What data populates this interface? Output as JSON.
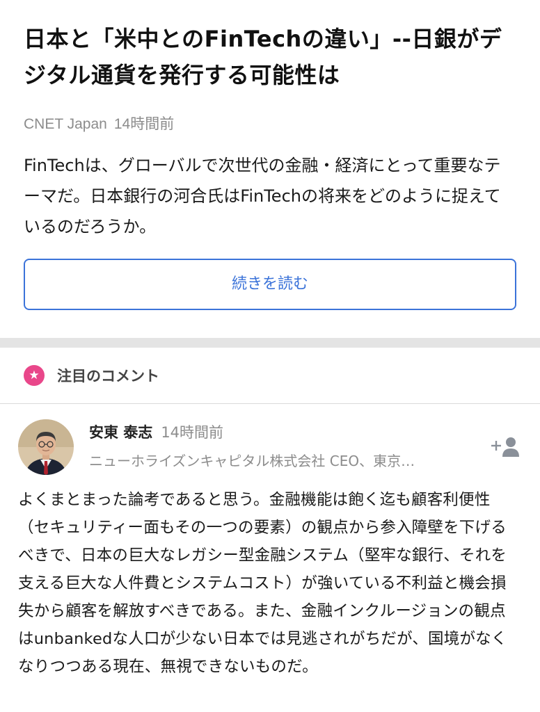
{
  "article": {
    "headline": "日本と「米中とのFinTechの違い」--日銀がデジタル通貨を発行する可能性は",
    "source": "CNET Japan",
    "time": "14時間前",
    "summary": "FinTechは、グローバルで次世代の金融・経済にとって重要なテーマだ。日本銀行の河合氏はFinTechの将来をどのように捉えているのだろうか。",
    "read_more_label": "続きを読む"
  },
  "comments_section": {
    "title": "注目のコメント",
    "badge_icon": "star-icon",
    "accent_color": "#e9478a"
  },
  "comment": {
    "author": "安東 泰志",
    "time": "14時間前",
    "affiliation": "ニューホライズンキャピタル株式会社 CEO、東京…",
    "follow_icon": "add-user-icon",
    "body": "よくまとまった論考であると思う。金融機能は飽く迄も顧客利便性（セキュリティー面もその一つの要素）の観点から参入障壁を下げるべきで、日本の巨大なレガシー型金融システム（堅牢な銀行、それを支える巨大な人件費とシステムコスト）が強いている不利益と機会損失から顧客を解放すべきである。また、金融インクルージョンの観点はunbankedな人口が少ない日本では見逃されがちだが、国境がなくなりつつある現在、無視できないものだ。"
  },
  "colors": {
    "link_blue": "#3b73d9",
    "meta_gray": "#8c8c8c",
    "divider_gray": "#e4e4e4"
  }
}
